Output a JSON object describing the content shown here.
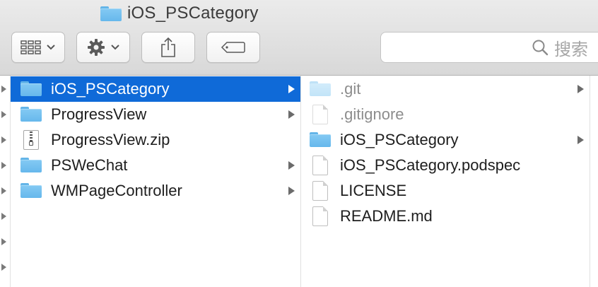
{
  "window": {
    "title": "iOS_PSCategory",
    "title_icon": "folder-icon"
  },
  "toolbar": {
    "view_button_icon": "icon-view-grid-icon",
    "action_button_icon": "gear-icon",
    "share_button_icon": "share-icon",
    "tag_button_icon": "tag-icon",
    "search_placeholder": "搜索"
  },
  "colors": {
    "selection": "#0f6ad8",
    "folder": "#6bbaec",
    "toolbar": "#e0e0e0"
  },
  "column1": {
    "items": [
      {
        "label": "iOS_PSCategory",
        "icon": "folder-icon",
        "has_children": true,
        "selected": true
      },
      {
        "label": "ProgressView",
        "icon": "folder-icon",
        "has_children": true,
        "selected": false
      },
      {
        "label": "ProgressView.zip",
        "icon": "zip-icon",
        "has_children": false,
        "selected": false
      },
      {
        "label": "PSWeChat",
        "icon": "folder-icon",
        "has_children": true,
        "selected": false
      },
      {
        "label": "WMPageController",
        "icon": "folder-icon",
        "has_children": true,
        "selected": false
      }
    ]
  },
  "column2": {
    "items": [
      {
        "label": ".git",
        "icon": "folder-icon",
        "has_children": true,
        "hidden_file": true
      },
      {
        "label": ".gitignore",
        "icon": "document-icon",
        "has_children": false,
        "hidden_file": true
      },
      {
        "label": "iOS_PSCategory",
        "icon": "folder-icon",
        "has_children": true,
        "hidden_file": false
      },
      {
        "label": "iOS_PSCategory.podspec",
        "icon": "document-icon",
        "has_children": false,
        "hidden_file": false
      },
      {
        "label": "LICENSE",
        "icon": "document-icon",
        "has_children": false,
        "hidden_file": false
      },
      {
        "label": "README.md",
        "icon": "document-icon",
        "has_children": false,
        "hidden_file": false
      }
    ]
  }
}
